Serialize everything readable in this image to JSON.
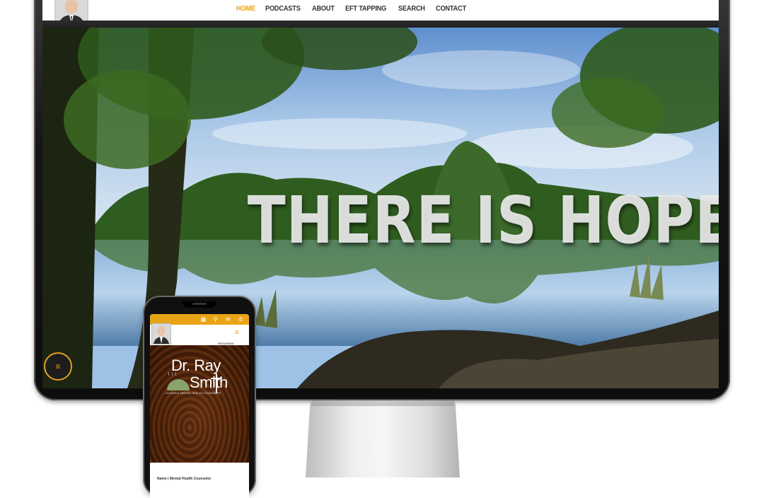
{
  "nav": {
    "items": [
      {
        "label": "HOME",
        "active": true
      },
      {
        "label": "PODCASTS"
      },
      {
        "label": "ABOUT"
      },
      {
        "label": "EFT TAPPING"
      },
      {
        "label": "SEARCH"
      },
      {
        "label": "CONTACT"
      }
    ],
    "accent_color": "#e8a414"
  },
  "hero": {
    "headline": "THERE IS HOPE"
  },
  "menu_button": {
    "icon": "hamburger-menu-icon",
    "glyph": "≡"
  },
  "phone": {
    "topbar_icons": [
      "calendar-icon",
      "location-pin-icon",
      "envelope-icon",
      "phone-icon"
    ],
    "topbar_glyphs": [
      "▦",
      "⚲",
      "✉",
      "✆"
    ],
    "menu_glyph": "≡",
    "tagline": "REGAINING PROGRESS",
    "brand_line1": "Dr. Ray",
    "brand_line2": "Smith",
    "brand_subtitle": "LICENSED MENTAL HEALTH COUNSELOR",
    "bottom_text": "Name | Mental Health Counselor"
  }
}
